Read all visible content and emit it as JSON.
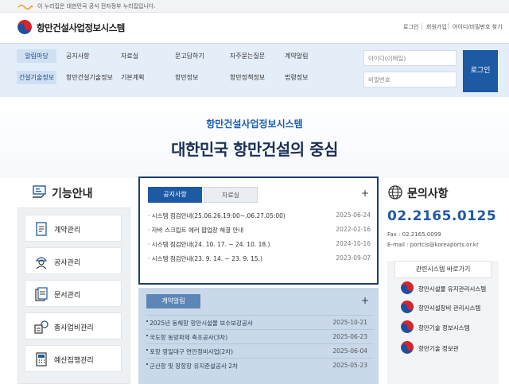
{
  "gov_banner": {
    "text": "이 누리집은 대한민국 공식 전자정부 누리집입니다."
  },
  "header": {
    "site_title": "항만건설사업정보시스템",
    "util_links": [
      "로그인",
      "회원가입",
      "아이디/비밀번호 찾기"
    ]
  },
  "nav": {
    "row1": {
      "pill": "알림마당",
      "items": [
        "공지사항",
        "자료실",
        "문고답하기",
        "자주묻는질문",
        "계약알림"
      ]
    },
    "row2": {
      "pill": "건설기술정보",
      "items": [
        "항만건설기술정보",
        "기본계획",
        "항만정보",
        "항만정책정보",
        "법령정보"
      ]
    },
    "login": {
      "id_placeholder": "아이디(이메일)",
      "pw_placeholder": "비밀번호",
      "button": "로그인"
    }
  },
  "hero": {
    "subtitle": "항만건설사업정보시스템",
    "headline": "대한민국 항만건설의 중심"
  },
  "functions": {
    "title": "기능안내",
    "items": [
      {
        "label": "계약관리",
        "icon": "contract-icon"
      },
      {
        "label": "공사관리",
        "icon": "worker-icon"
      },
      {
        "label": "문서관리",
        "icon": "document-icon"
      },
      {
        "label": "총사업비관리",
        "icon": "budget-icon"
      },
      {
        "label": "예산집행관리",
        "icon": "calculator-icon"
      }
    ]
  },
  "notice": {
    "tabs": [
      "공지사항",
      "자료실"
    ],
    "more": "+",
    "rows": [
      {
        "title": "시스템 점검안내(25.06.26.19:00~.06.27.05:00)",
        "date": "2025-06-24"
      },
      {
        "title": "자바 스크립트 에러 팝업창 해결 안내",
        "date": "2022-02-16"
      },
      {
        "title": "시스템 점검안내(24. 10. 17. ~ 24. 10. 18.)",
        "date": "2024-10-16"
      },
      {
        "title": "시스템 점검안내(23. 9. 14. ~ 23. 9. 15.)",
        "date": "2023-09-07"
      }
    ]
  },
  "contract": {
    "tab": "계약알림",
    "more": "+",
    "rows": [
      {
        "title": "2025년 동해항 항만시설물 보수보강공사",
        "date": "2025-10-21"
      },
      {
        "title": "국도항 동방파제 축조공사(3차)",
        "date": "2025-06-23"
      },
      {
        "title": "포항 영일대구 연안정비사업(2차)",
        "date": "2025-06-04"
      },
      {
        "title": "군산항 및 장항항 유지준설공사 2차",
        "date": "2025-05-23"
      }
    ]
  },
  "inquiry": {
    "title": "문의사항",
    "phone": "02.2165.0125",
    "fax": "Fax : 02.2165.0099",
    "email": "E-mail : portcis@koreaports.or.kr"
  },
  "related": {
    "title": "관련시스템 바로가기",
    "items": [
      "항만시설물 유지관리시스템",
      "항만시설장비 관리시스템",
      "항만기술 정보시스템",
      "항만기술 정보관"
    ]
  },
  "colors": {
    "primary": "#1d5aa3",
    "navy": "#1a2f57",
    "nav_bg": "#e4eef8",
    "contract_bg": "#c9d9ea"
  }
}
